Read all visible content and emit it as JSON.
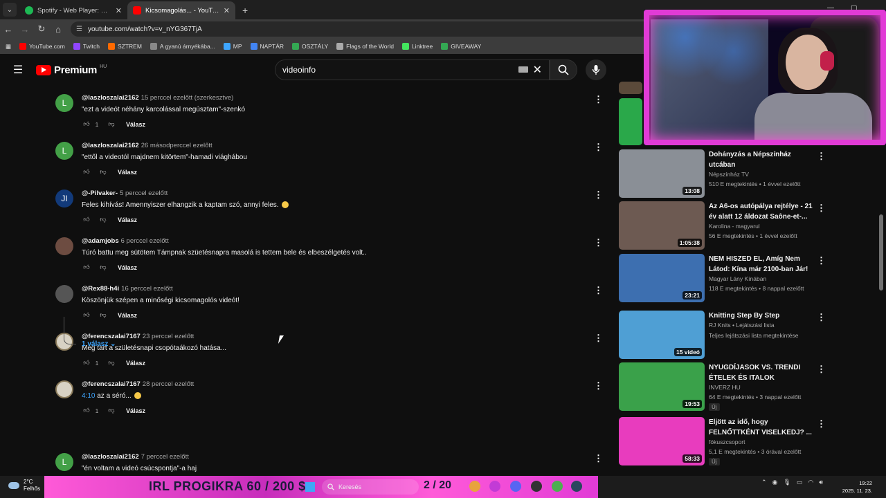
{
  "browser": {
    "tabs": [
      {
        "label": "Spotify - Web Player: Music for...",
        "active": false,
        "color": "#1db954"
      },
      {
        "label": "Kicsomagolás... - YouTube",
        "active": true,
        "color": "#ff0000"
      }
    ],
    "url": "youtube.com/watch?v=v_nYG367TjA",
    "bookmarks": [
      {
        "label": "YouTube.com",
        "color": "#ff0000"
      },
      {
        "label": "Twitch",
        "color": "#9146ff"
      },
      {
        "label": "SZTREM",
        "color": "#ff6a00"
      },
      {
        "label": "A gyanú árnyékába...",
        "color": "#888888"
      },
      {
        "label": "MP",
        "color": "#3ea6ff"
      },
      {
        "label": "NAPTÁR",
        "color": "#4285f4"
      },
      {
        "label": "OSZTÁLY",
        "color": "#34a853"
      },
      {
        "label": "Flags of the World",
        "color": "#aaaaaa"
      },
      {
        "label": "Linktree",
        "color": "#43e55e"
      },
      {
        "label": "GIVEAWAY",
        "color": "#34a853"
      }
    ]
  },
  "youtube": {
    "logo": "Premium",
    "country": "HU",
    "search_value": "videoinfo"
  },
  "comments": [
    {
      "author": "@laszloszalai2162",
      "time": "15 perccel ezelőtt (szerkesztve)",
      "text": "\"ezt a videót néhány karcolással megúsztam\"-szenkó",
      "likes": "1",
      "avatar_letter": "L",
      "avatar_color": "#43a047"
    },
    {
      "author": "@laszloszalai2162",
      "time": "26 másodperccel ezelőtt",
      "text": "\"ettől a videotól majdnem kitörtem\"-hamadi viághábou",
      "likes": "",
      "avatar_letter": "L",
      "avatar_color": "#43a047"
    },
    {
      "author": "@-Pilvaker-",
      "time": "5 perccel ezelőtt",
      "text": "Feles kihívás!  Amennyiszer elhangzik a kaptam szó, annyi feles.",
      "likes": "",
      "avatar_letter": "JI",
      "avatar_color": "#123a7a"
    },
    {
      "author": "@adamjobs",
      "time": "6 perccel ezelőtt",
      "text": "Túró battu meg sütötem Támpnak szüetésnapra masolá is tettem bele és elbeszélgetés volt..",
      "likes": "",
      "avatar_letter": "",
      "avatar_color": "#6d4c41"
    },
    {
      "author": "@Rex88-h4i",
      "time": "16 perccel ezelőtt",
      "text": "Köszönjük szépen a minőségi kicsomagolós videót!",
      "likes": "",
      "avatar_letter": "",
      "avatar_color": "#555555"
    },
    {
      "author": "@ferencszalai7167",
      "time": "23 perccel ezelőtt",
      "text": "Még tart a születésnapi csopótaákozó hatása...",
      "likes": "1",
      "avatar_letter": "",
      "avatar_color": "#d8d2c4"
    },
    {
      "author": "@ferencszalai7167",
      "time": "28 perccel ezelőtt",
      "link": "4:10",
      "text": " az a séró...",
      "likes": "1",
      "avatar_letter": "",
      "avatar_color": "#d8d2c4"
    },
    {
      "author": "@laszloszalai2162",
      "time": "7 perccel ezelőtt",
      "text": "\"én voltam a videó csúcspontja\"-a haj",
      "likes": "",
      "avatar_letter": "L",
      "avatar_color": "#43a047"
    }
  ],
  "reply_label": "Válasz",
  "replies_toggle": "1 válasz",
  "recommendations": [
    {
      "title": "Dohányzás a Népszínház utcában",
      "channel": "Népszínház TV",
      "meta": "510 E megtekintés • 1 évvel ezelőtt",
      "duration": "13:08",
      "badge": "",
      "color": "#8a8f96"
    },
    {
      "title": "Az A6-os autópálya rejtélye - 21 év alatt 12 áldozat Saône-et-...",
      "channel": "Karolina - magyarul",
      "meta": "56 E megtekintés • 1 évvel ezelőtt",
      "duration": "1:05:38",
      "badge": "",
      "color": "#6d5a52"
    },
    {
      "title": "NEM HISZED EL, Amíg Nem Látod: Kína már 2100-ban Jár!",
      "channel": "Magyar Lány Kínában",
      "meta": "118 E megtekintés • 8 nappal ezelőtt",
      "duration": "23:21",
      "badge": "",
      "color": "#3d6fb0"
    },
    {
      "title": "Knitting Step By Step",
      "channel": "RJ Knits • Lejátszási lista",
      "meta": "Teljes lejátszási lista megtekintése",
      "duration": "15 videó",
      "badge": "",
      "color": "#4f9fd4"
    },
    {
      "title": "NYUGDÍJASOK VS. TRENDI ÉTELEK ÉS ITALOK",
      "channel": "INVERZ HU",
      "meta": "64 E megtekintés • 3 nappal ezelőtt",
      "duration": "19:53",
      "badge": "Új",
      "color": "#3aa14a"
    },
    {
      "title": "Eljött az idő, hogy FELNŐTTKÉNT VISELKEDJ? ...",
      "channel": "fókuszcsoport",
      "meta": "5,1 E megtekintés • 3 órával ezelőtt",
      "duration": "58:33",
      "badge": "Új",
      "color": "#e83cbe"
    }
  ],
  "overlay": {
    "goal_label": "IRL PROGIKRA",
    "goal_amount": "60 / 200 $",
    "counter": "2 / 20"
  },
  "taskbar": {
    "temp": "2°C",
    "weather": "Felhős",
    "search_placeholder": "Keresés",
    "time": "19:22",
    "date": "2025. 11. 23."
  }
}
